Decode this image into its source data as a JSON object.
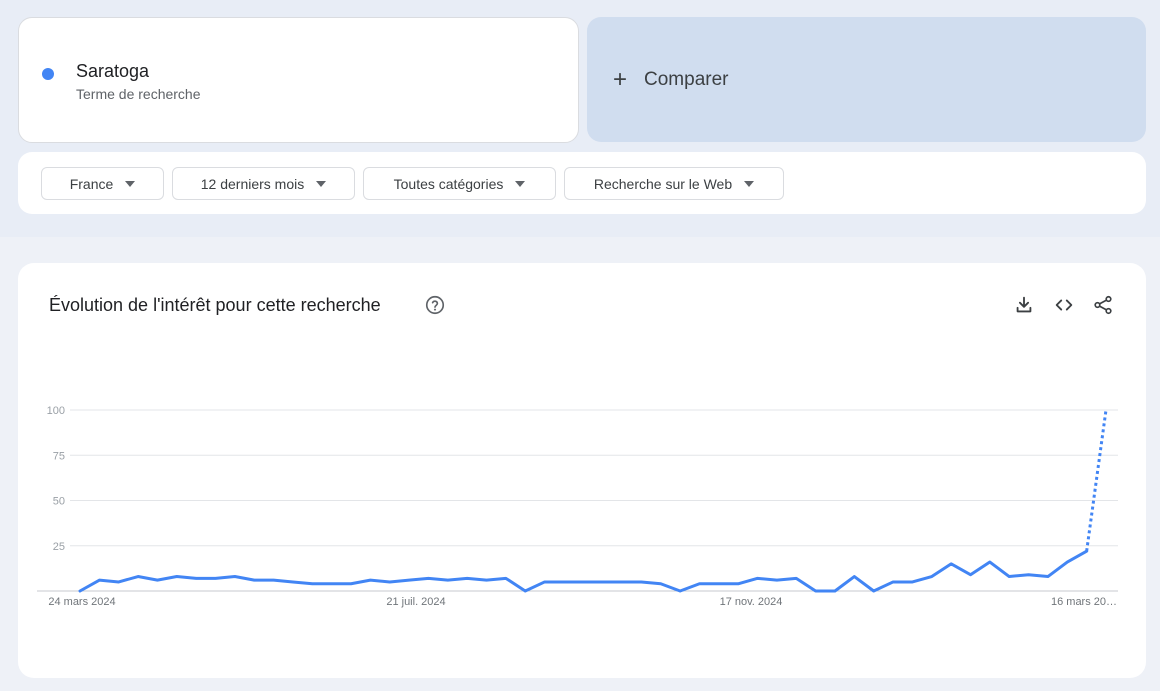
{
  "term": {
    "name": "Saratoga",
    "type": "Terme de recherche",
    "color": "#4285f4"
  },
  "compare": {
    "icon": "plus-icon",
    "label": "Comparer"
  },
  "filters": [
    {
      "label": "France"
    },
    {
      "label": "12 derniers mois"
    },
    {
      "label": "Toutes catégories"
    },
    {
      "label": "Recherche sur le Web"
    }
  ],
  "panel": {
    "title": "Évolution de l'intérêt pour cette recherche",
    "icons": [
      "help-icon",
      "download-icon",
      "embed-code-icon",
      "share-icon"
    ]
  },
  "chart_data": {
    "type": "line",
    "ylim": [
      0,
      100
    ],
    "y_ticks": [
      "100",
      "75",
      "50",
      "25"
    ],
    "x_tick_labels": [
      "24 mars 2024",
      "21 juil. 2024",
      "17 nov. 2024",
      "16 mars 20…"
    ],
    "grid": true,
    "line_color": "#4285f4",
    "series": [
      {
        "values": [
          0,
          6,
          5,
          8,
          6,
          8,
          7,
          7,
          8,
          6,
          6,
          5,
          4,
          4,
          4,
          6,
          5,
          6,
          7,
          6,
          7,
          6,
          7,
          0,
          5,
          5,
          5,
          5,
          5,
          5,
          4,
          0,
          4,
          4,
          4,
          7,
          6,
          7,
          0,
          0,
          8,
          0,
          5,
          5,
          8,
          15,
          9,
          16,
          8,
          9,
          8,
          16,
          22,
          100
        ],
        "partial_last_point": true
      }
    ]
  }
}
